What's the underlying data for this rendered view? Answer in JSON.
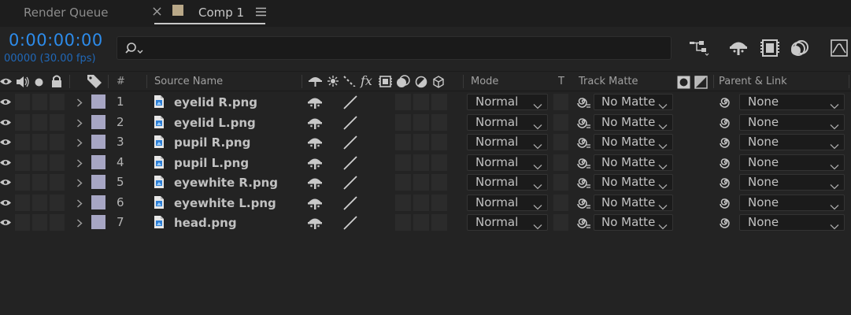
{
  "tabs": {
    "render_queue": "Render Queue",
    "comp": "Comp 1"
  },
  "header": {
    "timecode": "0:00:00:00",
    "frames_fps": "00000 (30.00 fps)",
    "search_placeholder": ""
  },
  "columns": {
    "number": "#",
    "source_name": "Source Name",
    "mode": "Mode",
    "t": "T",
    "track_matte": "Track Matte",
    "parent_link": "Parent & Link"
  },
  "layers": [
    {
      "num": "1",
      "name": "eyelid R.png",
      "mode": "Normal",
      "matte": "No Matte",
      "parent": "None"
    },
    {
      "num": "2",
      "name": "eyelid L.png",
      "mode": "Normal",
      "matte": "No Matte",
      "parent": "None"
    },
    {
      "num": "3",
      "name": "pupil R.png",
      "mode": "Normal",
      "matte": "No Matte",
      "parent": "None"
    },
    {
      "num": "4",
      "name": "pupil L.png",
      "mode": "Normal",
      "matte": "No Matte",
      "parent": "None"
    },
    {
      "num": "5",
      "name": "eyewhite R.png",
      "mode": "Normal",
      "matte": "No Matte",
      "parent": "None"
    },
    {
      "num": "6",
      "name": "eyewhite L.png",
      "mode": "Normal",
      "matte": "No Matte",
      "parent": "None"
    },
    {
      "num": "7",
      "name": "head.png",
      "mode": "Normal",
      "matte": "No Matte",
      "parent": "None"
    }
  ],
  "colors": {
    "timecode": "#2d8ceb",
    "label_swatch": "#a7a6c4",
    "comp_swatch": "#b9a888"
  }
}
